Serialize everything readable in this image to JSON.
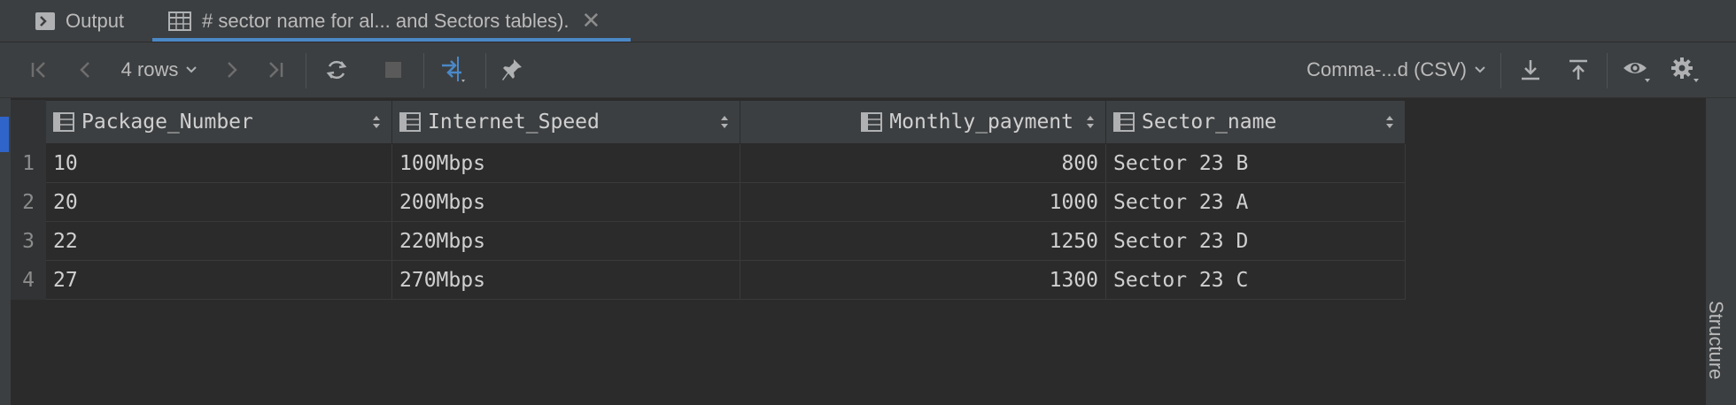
{
  "tabs": [
    {
      "label": "Output",
      "icon": "console-icon",
      "active": false
    },
    {
      "label": "# sector name for al... and Sectors tables).",
      "icon": "table-icon",
      "active": true
    }
  ],
  "toolbar": {
    "rows_label": "4 rows",
    "export_format": "Comma-...d (CSV)"
  },
  "grid": {
    "columns": [
      "Package_Number",
      "Internet_Speed",
      "Monthly_payment",
      "Sector_name"
    ],
    "rows": [
      {
        "num": "1",
        "cells": [
          "10",
          "100Mbps",
          "800",
          "Sector 23 B"
        ]
      },
      {
        "num": "2",
        "cells": [
          "20",
          "200Mbps",
          "1000",
          "Sector 23 A"
        ]
      },
      {
        "num": "3",
        "cells": [
          "22",
          "220Mbps",
          "1250",
          "Sector 23 D"
        ]
      },
      {
        "num": "4",
        "cells": [
          "27",
          "270Mbps",
          "1300",
          "Sector 23 C"
        ]
      }
    ]
  },
  "side_panel": {
    "label": "Structure"
  },
  "colors": {
    "accent": "#4a88c7",
    "background": "#2b2b2b",
    "panel": "#3c3f41"
  }
}
